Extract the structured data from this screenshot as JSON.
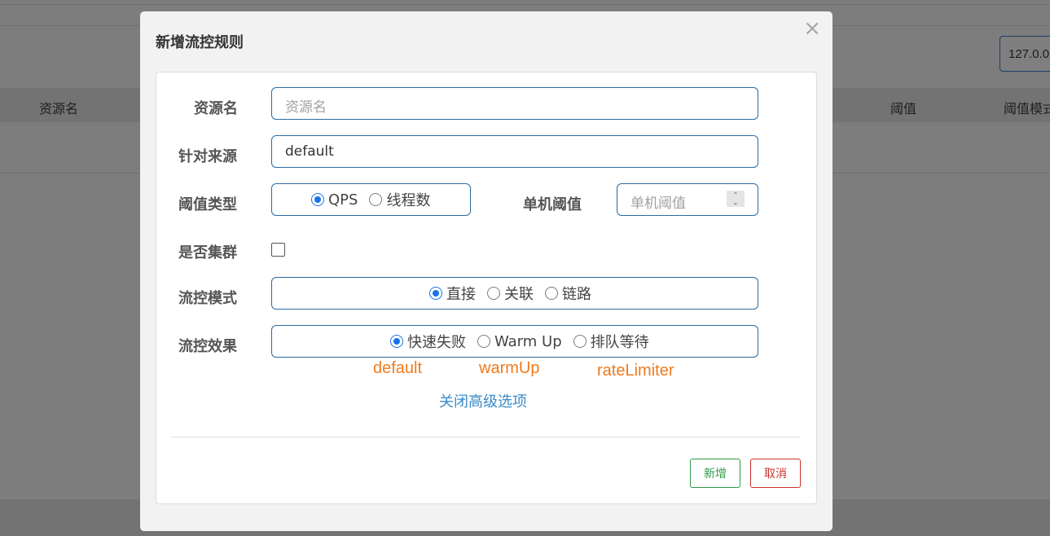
{
  "background": {
    "ip_value": "127.0.0",
    "columns": [
      "资源名",
      "阈值",
      "阈值模式"
    ]
  },
  "modal": {
    "title": "新增流控规则",
    "close_icon": "close-icon",
    "fields": {
      "resource": {
        "label": "资源名",
        "placeholder": "资源名"
      },
      "origin": {
        "label": "针对来源",
        "value": "default"
      },
      "threshold_type": {
        "label": "阈值类型",
        "options": [
          "QPS",
          "线程数"
        ],
        "selected": "QPS"
      },
      "single_threshold": {
        "label": "单机阈值",
        "placeholder": "单机阈值"
      },
      "cluster": {
        "label": "是否集群",
        "checked": false
      },
      "flow_mode": {
        "label": "流控模式",
        "options": [
          "直接",
          "关联",
          "链路"
        ],
        "selected": "直接"
      },
      "flow_effect": {
        "label": "流控效果",
        "options": [
          "快速失败",
          "Warm Up",
          "排队等待"
        ],
        "selected": "快速失败"
      }
    },
    "annotations": [
      "default",
      "warmUp",
      "rateLimiter"
    ],
    "advanced_link": "关闭高级选项",
    "buttons": {
      "add": "新增",
      "cancel": "取消"
    }
  },
  "colors": {
    "accent": "#1a73e8",
    "border": "#2c6aa0",
    "annotation": "#f07a1c",
    "link": "#3a8ac7",
    "add_button": "#2d9a46",
    "cancel_button": "#c9302c"
  }
}
